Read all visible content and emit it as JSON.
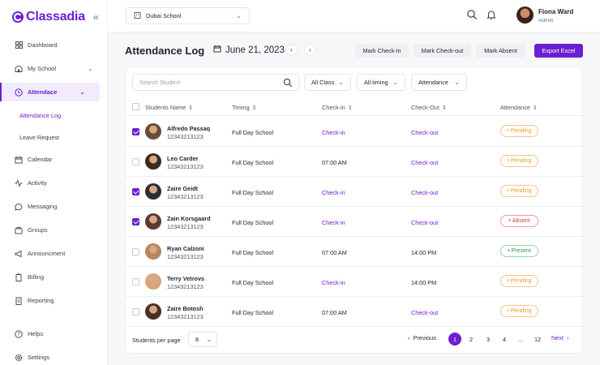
{
  "app": {
    "name": "Classadia",
    "brand_color": "#6a1fd1"
  },
  "sidebar": {
    "collapse_icon": "double-chevron-left-icon",
    "items": [
      {
        "label": "Dashboard",
        "icon": "grid-icon"
      },
      {
        "label": "My School",
        "icon": "school-icon"
      },
      {
        "label": "Attendace",
        "icon": "clock-icon"
      },
      {
        "label": "Calendar",
        "icon": "calendar-icon"
      },
      {
        "label": "Activity",
        "icon": "activity-icon"
      },
      {
        "label": "Messaging",
        "icon": "message-icon"
      },
      {
        "label": "Groups",
        "icon": "groups-icon"
      },
      {
        "label": "Announcment",
        "icon": "megaphone-icon"
      },
      {
        "label": "Billing",
        "icon": "clipboard-icon"
      },
      {
        "label": "Reporting",
        "icon": "report-icon"
      }
    ],
    "sub_items": [
      {
        "label": "Attendance Log"
      },
      {
        "label": "Leave Request"
      }
    ],
    "bottom": [
      {
        "label": "Helps",
        "icon": "help-icon"
      },
      {
        "label": "Settings",
        "icon": "gear-icon"
      }
    ]
  },
  "header": {
    "school": "Dubai School",
    "user_name": "Fiona Ward",
    "user_role": "Admin"
  },
  "page": {
    "title": "Attendance Log",
    "date": "June 21, 2023",
    "buttons": {
      "check_in": "Mark Check-in",
      "check_out": "Mark Check-out",
      "absent": "Mark Absent",
      "export": "Export Excel"
    }
  },
  "filters": {
    "search_placeholder": "Search Student",
    "class": "All Class",
    "timing": "All timing",
    "attendance": "Attendance"
  },
  "table": {
    "columns": [
      "Students Name",
      "Timing",
      "Check-in",
      "Check-Out",
      "Attendance"
    ],
    "rows": [
      {
        "name": "Alfredo Passaq",
        "id": "12343213123",
        "timing": "Full Day School",
        "check_in": "Check-in",
        "check_out": "Check-out",
        "status": "Pending",
        "checked": true,
        "check_in_link": true,
        "check_out_link": true
      },
      {
        "name": "Leo Carder",
        "id": "12343213123",
        "timing": "Full Day School",
        "check_in": "07:00 AM",
        "check_out": "Check-out",
        "status": "Pending",
        "checked": false,
        "check_in_link": false,
        "check_out_link": true
      },
      {
        "name": "Zaire Geidt",
        "id": "12343213123",
        "timing": "Full Day School",
        "check_in": "Check-in",
        "check_out": "Check-out",
        "status": "Pending",
        "checked": true,
        "check_in_link": true,
        "check_out_link": true
      },
      {
        "name": "Zain Korsgaard",
        "id": "12343213123",
        "timing": "Full Day School",
        "check_in": "Check-in",
        "check_out": "Check-out",
        "status": "Absent",
        "checked": true,
        "check_in_link": true,
        "check_out_link": true
      },
      {
        "name": "Ryan Calzoni",
        "id": "12343213123",
        "timing": "Full Day School",
        "check_in": "07:00 AM",
        "check_out": "14:00 PM",
        "status": "Present",
        "checked": false,
        "check_in_link": false,
        "check_out_link": false
      },
      {
        "name": "Terry Vetrovs",
        "id": "12343213123",
        "timing": "Full Day School",
        "check_in": "Check-in",
        "check_out": "14:00 PM",
        "status": "Pending",
        "checked": false,
        "check_in_link": true,
        "check_out_link": false
      },
      {
        "name": "Zaire Botosh",
        "id": "12343213123",
        "timing": "Full Day School",
        "check_in": "07:00 AM",
        "check_out": "Check-out",
        "status": "Pending",
        "checked": false,
        "check_in_link": false,
        "check_out_link": true
      }
    ]
  },
  "pagination": {
    "per_page_label": "Students per page",
    "per_page": "8",
    "previous": "Previous",
    "next": "Next",
    "pages": [
      "1",
      "2",
      "3",
      "4",
      "...",
      "12"
    ],
    "current": "1"
  }
}
